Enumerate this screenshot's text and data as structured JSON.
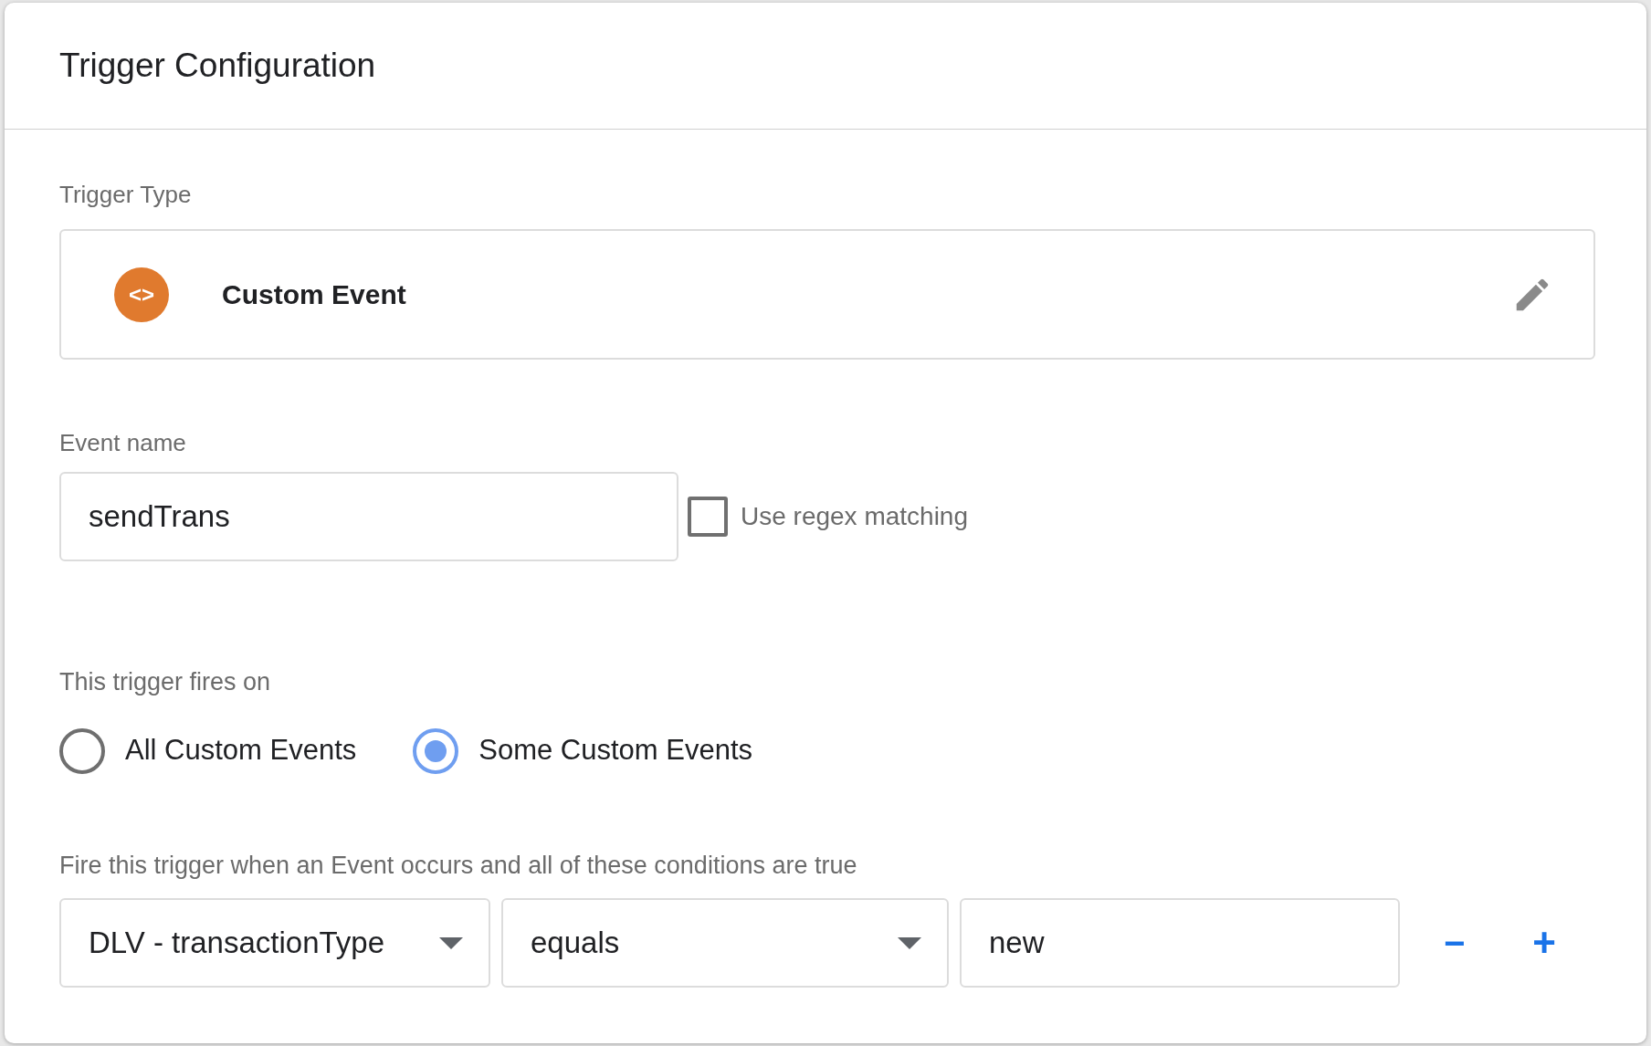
{
  "card": {
    "title": "Trigger Configuration"
  },
  "trigger_type": {
    "label": "Trigger Type",
    "name": "Custom Event",
    "icon_text": "<>"
  },
  "event_name": {
    "label": "Event name",
    "value": "sendTrans",
    "regex": {
      "label": "Use regex matching",
      "checked": false
    }
  },
  "fires_on": {
    "label": "This trigger fires on",
    "options": [
      {
        "label": "All Custom Events",
        "selected": false
      },
      {
        "label": "Some Custom Events",
        "selected": true
      }
    ]
  },
  "conditions": {
    "label": "Fire this trigger when an Event occurs and all of these conditions are true",
    "rows": [
      {
        "variable": "DLV - transactionType",
        "operator": "equals",
        "value": "new",
        "remove": "−",
        "add": "+"
      }
    ]
  }
}
